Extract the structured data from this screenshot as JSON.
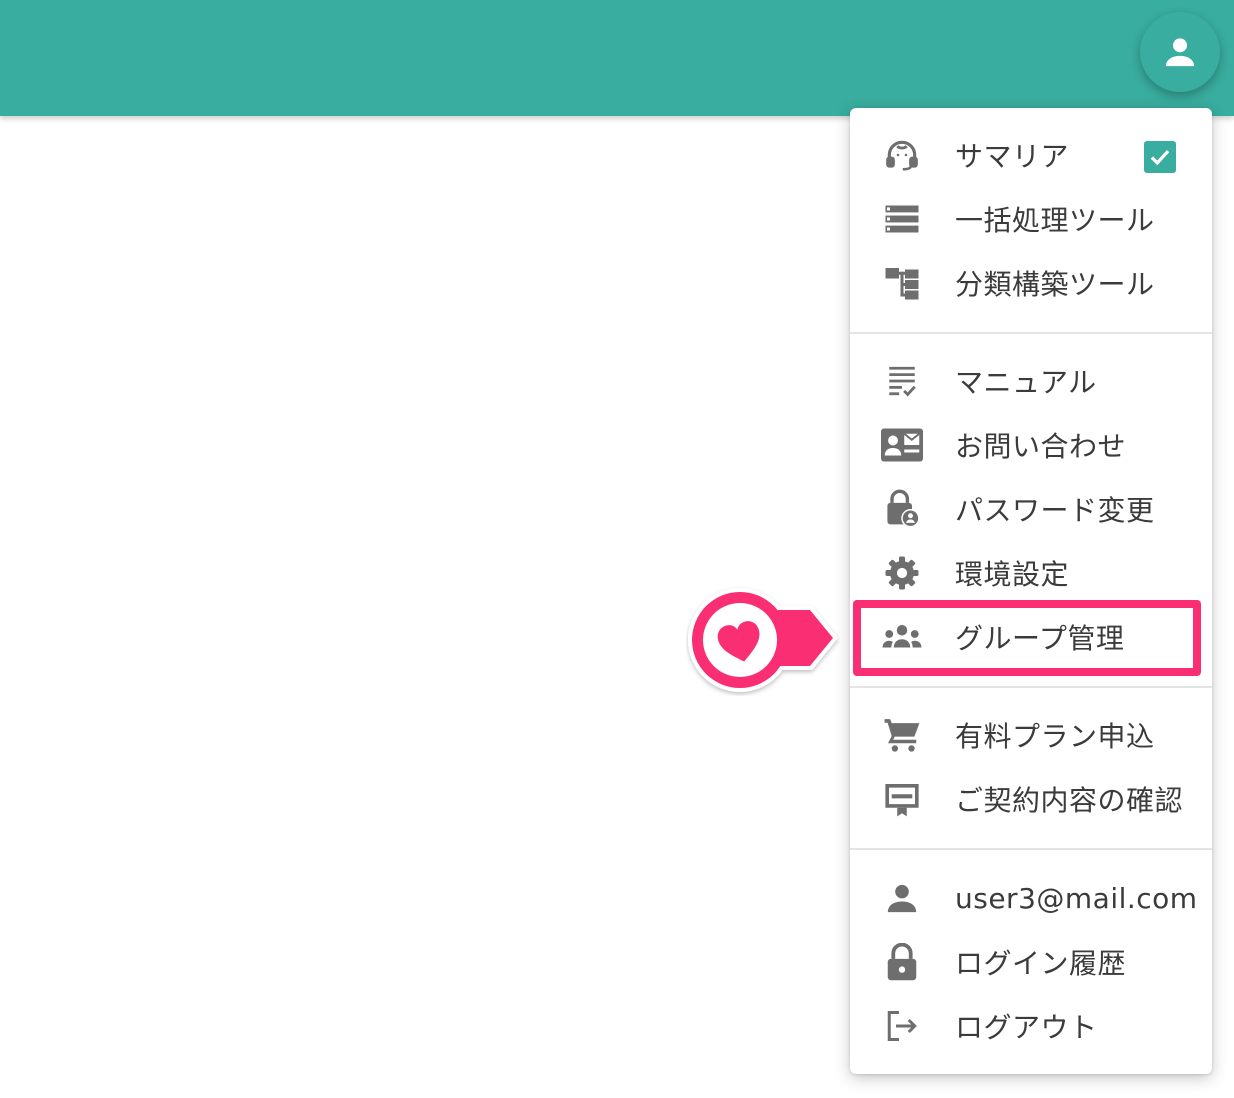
{
  "menu": {
    "items": [
      {
        "label": "サマリア",
        "icon": "headset-icon",
        "checked": true
      },
      {
        "label": "一括処理ツール",
        "icon": "list-icon"
      },
      {
        "label": "分類構築ツール",
        "icon": "tree-icon"
      },
      {
        "label": "マニュアル",
        "icon": "checklist-icon"
      },
      {
        "label": "お問い合わせ",
        "icon": "contact-card-icon"
      },
      {
        "label": "パスワード変更",
        "icon": "lock-person-icon"
      },
      {
        "label": "環境設定",
        "icon": "gear-icon"
      },
      {
        "label": "グループ管理",
        "icon": "group-icon"
      },
      {
        "label": "有料プラン申込",
        "icon": "cart-icon"
      },
      {
        "label": "ご契約内容の確認",
        "icon": "certificate-icon"
      },
      {
        "label": "user3@mail.com",
        "icon": "person-icon"
      },
      {
        "label": "ログイン履歴",
        "icon": "lock-icon"
      },
      {
        "label": "ログアウト",
        "icon": "logout-icon"
      }
    ]
  },
  "colors": {
    "teal": "#39ad9f",
    "highlight": "#fa2e72",
    "icon": "#6e6e6e",
    "text": "#3b3b3b"
  }
}
